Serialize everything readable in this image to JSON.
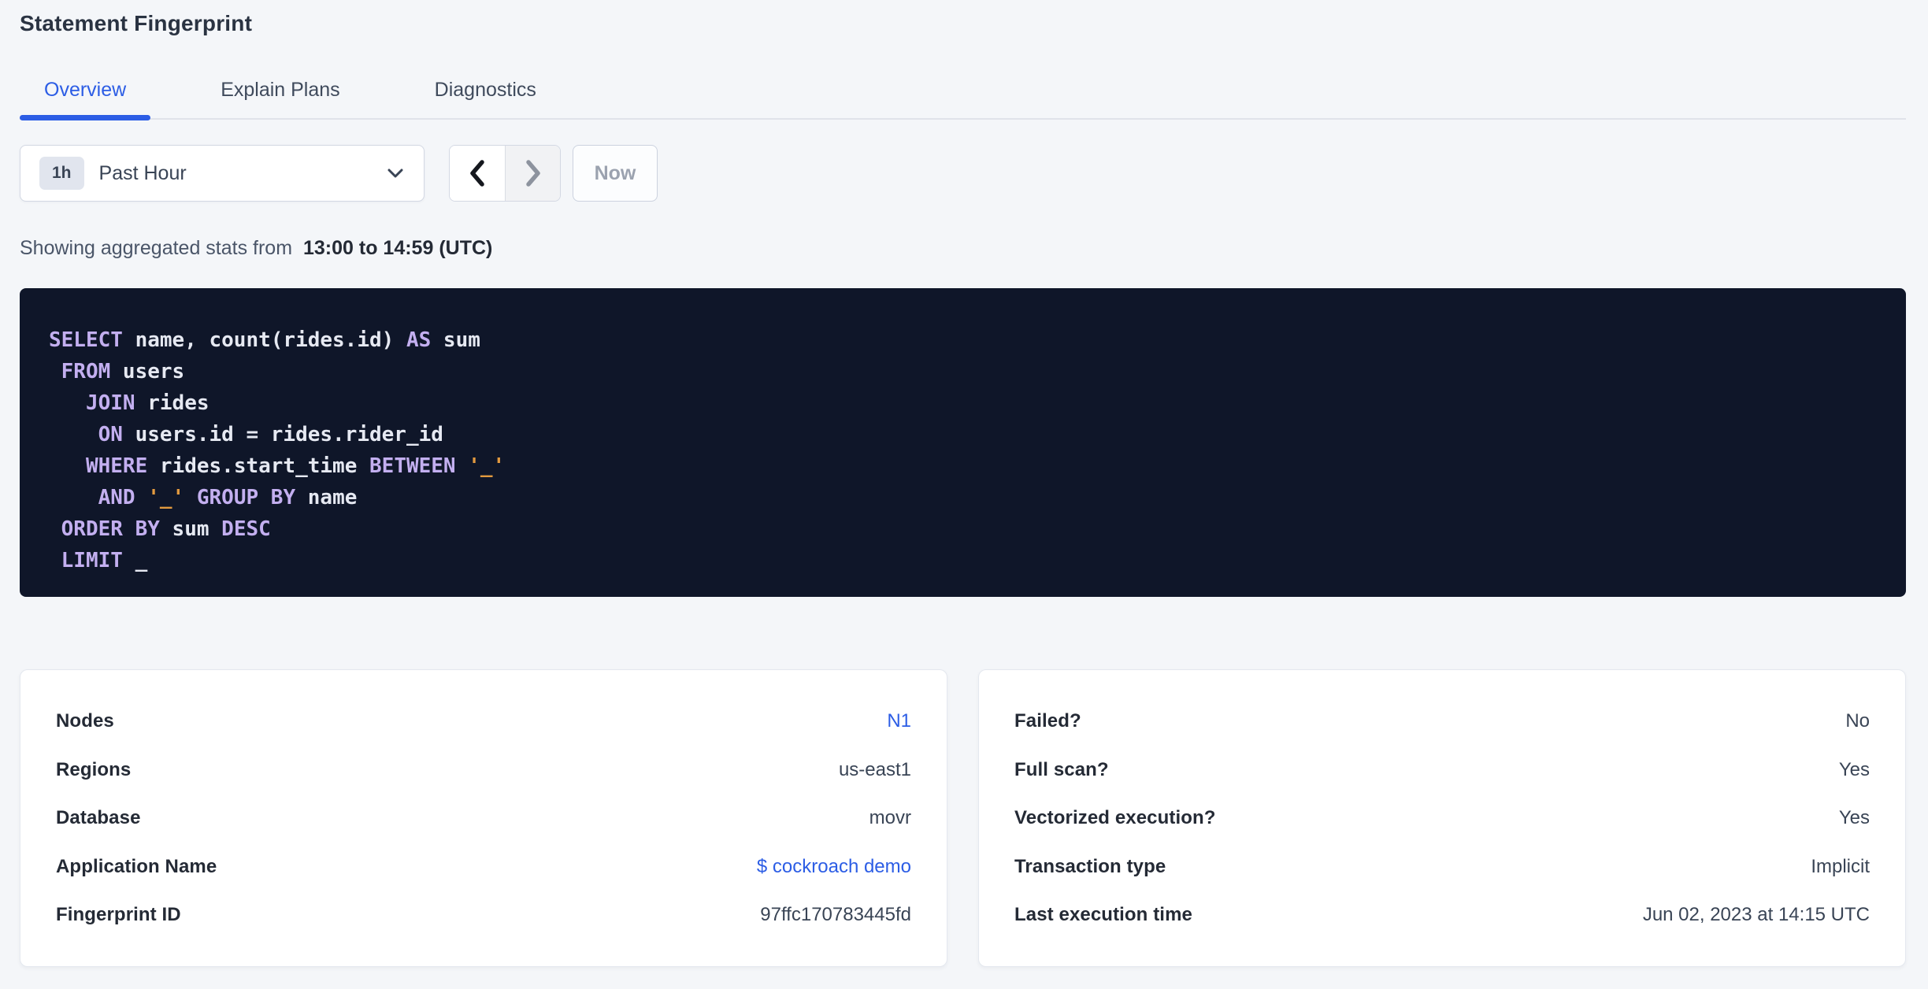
{
  "page": {
    "title": "Statement Fingerprint",
    "background": "#f4f6f9",
    "accent": "#2c5de5"
  },
  "tabs": [
    {
      "label": "Overview",
      "active": true
    },
    {
      "label": "Explain Plans",
      "active": false
    },
    {
      "label": "Diagnostics",
      "active": false
    }
  ],
  "time_picker": {
    "badge": "1h",
    "selected": "Past Hour",
    "prev_icon": "chevron-left",
    "next_icon": "chevron-right",
    "next_disabled": true,
    "now_label": "Now",
    "now_disabled": true
  },
  "stats_line": {
    "prefix": "Showing aggregated stats from",
    "range": "13:00 to 14:59 (UTC)"
  },
  "sql": {
    "background": "#0f1629",
    "colors": {
      "keyword": "#c3aff0",
      "plain": "#e6e9f2",
      "string": "#e39a3f"
    },
    "lines": [
      [
        {
          "c": "kw",
          "v": "SELECT"
        },
        {
          "c": "pl",
          "v": " name, count(rides.id) "
        },
        {
          "c": "kw",
          "v": "AS"
        },
        {
          "c": "pl",
          "v": " sum"
        }
      ],
      [
        {
          "c": "pl",
          "v": " "
        },
        {
          "c": "kw",
          "v": "FROM"
        },
        {
          "c": "pl",
          "v": " users"
        }
      ],
      [
        {
          "c": "pl",
          "v": "   "
        },
        {
          "c": "kw",
          "v": "JOIN"
        },
        {
          "c": "pl",
          "v": " rides"
        }
      ],
      [
        {
          "c": "pl",
          "v": "    "
        },
        {
          "c": "kw",
          "v": "ON"
        },
        {
          "c": "pl",
          "v": " users.id = rides.rider_id"
        }
      ],
      [
        {
          "c": "pl",
          "v": "   "
        },
        {
          "c": "kw",
          "v": "WHERE"
        },
        {
          "c": "pl",
          "v": " rides.start_time "
        },
        {
          "c": "kw",
          "v": "BETWEEN"
        },
        {
          "c": "pl",
          "v": " "
        },
        {
          "c": "str",
          "v": "'_'"
        }
      ],
      [
        {
          "c": "pl",
          "v": "    "
        },
        {
          "c": "kw",
          "v": "AND"
        },
        {
          "c": "pl",
          "v": " "
        },
        {
          "c": "str",
          "v": "'_'"
        },
        {
          "c": "pl",
          "v": " "
        },
        {
          "c": "kw",
          "v": "GROUP BY"
        },
        {
          "c": "pl",
          "v": " name"
        }
      ],
      [
        {
          "c": "pl",
          "v": " "
        },
        {
          "c": "kw",
          "v": "ORDER BY"
        },
        {
          "c": "pl",
          "v": " sum "
        },
        {
          "c": "kw",
          "v": "DESC"
        }
      ],
      [
        {
          "c": "pl",
          "v": " "
        },
        {
          "c": "kw",
          "v": "LIMIT"
        },
        {
          "c": "pl",
          "v": " _"
        }
      ]
    ]
  },
  "cards": {
    "left": {
      "rows": [
        {
          "label": "Nodes",
          "value": "N1",
          "link": true
        },
        {
          "label": "Regions",
          "value": "us-east1",
          "link": false
        },
        {
          "label": "Database",
          "value": "movr",
          "link": false
        },
        {
          "label": "Application Name",
          "value": "$ cockroach demo",
          "link": true
        },
        {
          "label": "Fingerprint ID",
          "value": "97ffc170783445fd",
          "link": false
        }
      ]
    },
    "right": {
      "rows": [
        {
          "label": "Failed?",
          "value": "No",
          "link": false
        },
        {
          "label": "Full scan?",
          "value": "Yes",
          "link": false
        },
        {
          "label": "Vectorized execution?",
          "value": "Yes",
          "link": false
        },
        {
          "label": "Transaction type",
          "value": "Implicit",
          "link": false
        },
        {
          "label": "Last execution time",
          "value": "Jun 02, 2023 at 14:15 UTC",
          "link": false
        }
      ]
    }
  }
}
